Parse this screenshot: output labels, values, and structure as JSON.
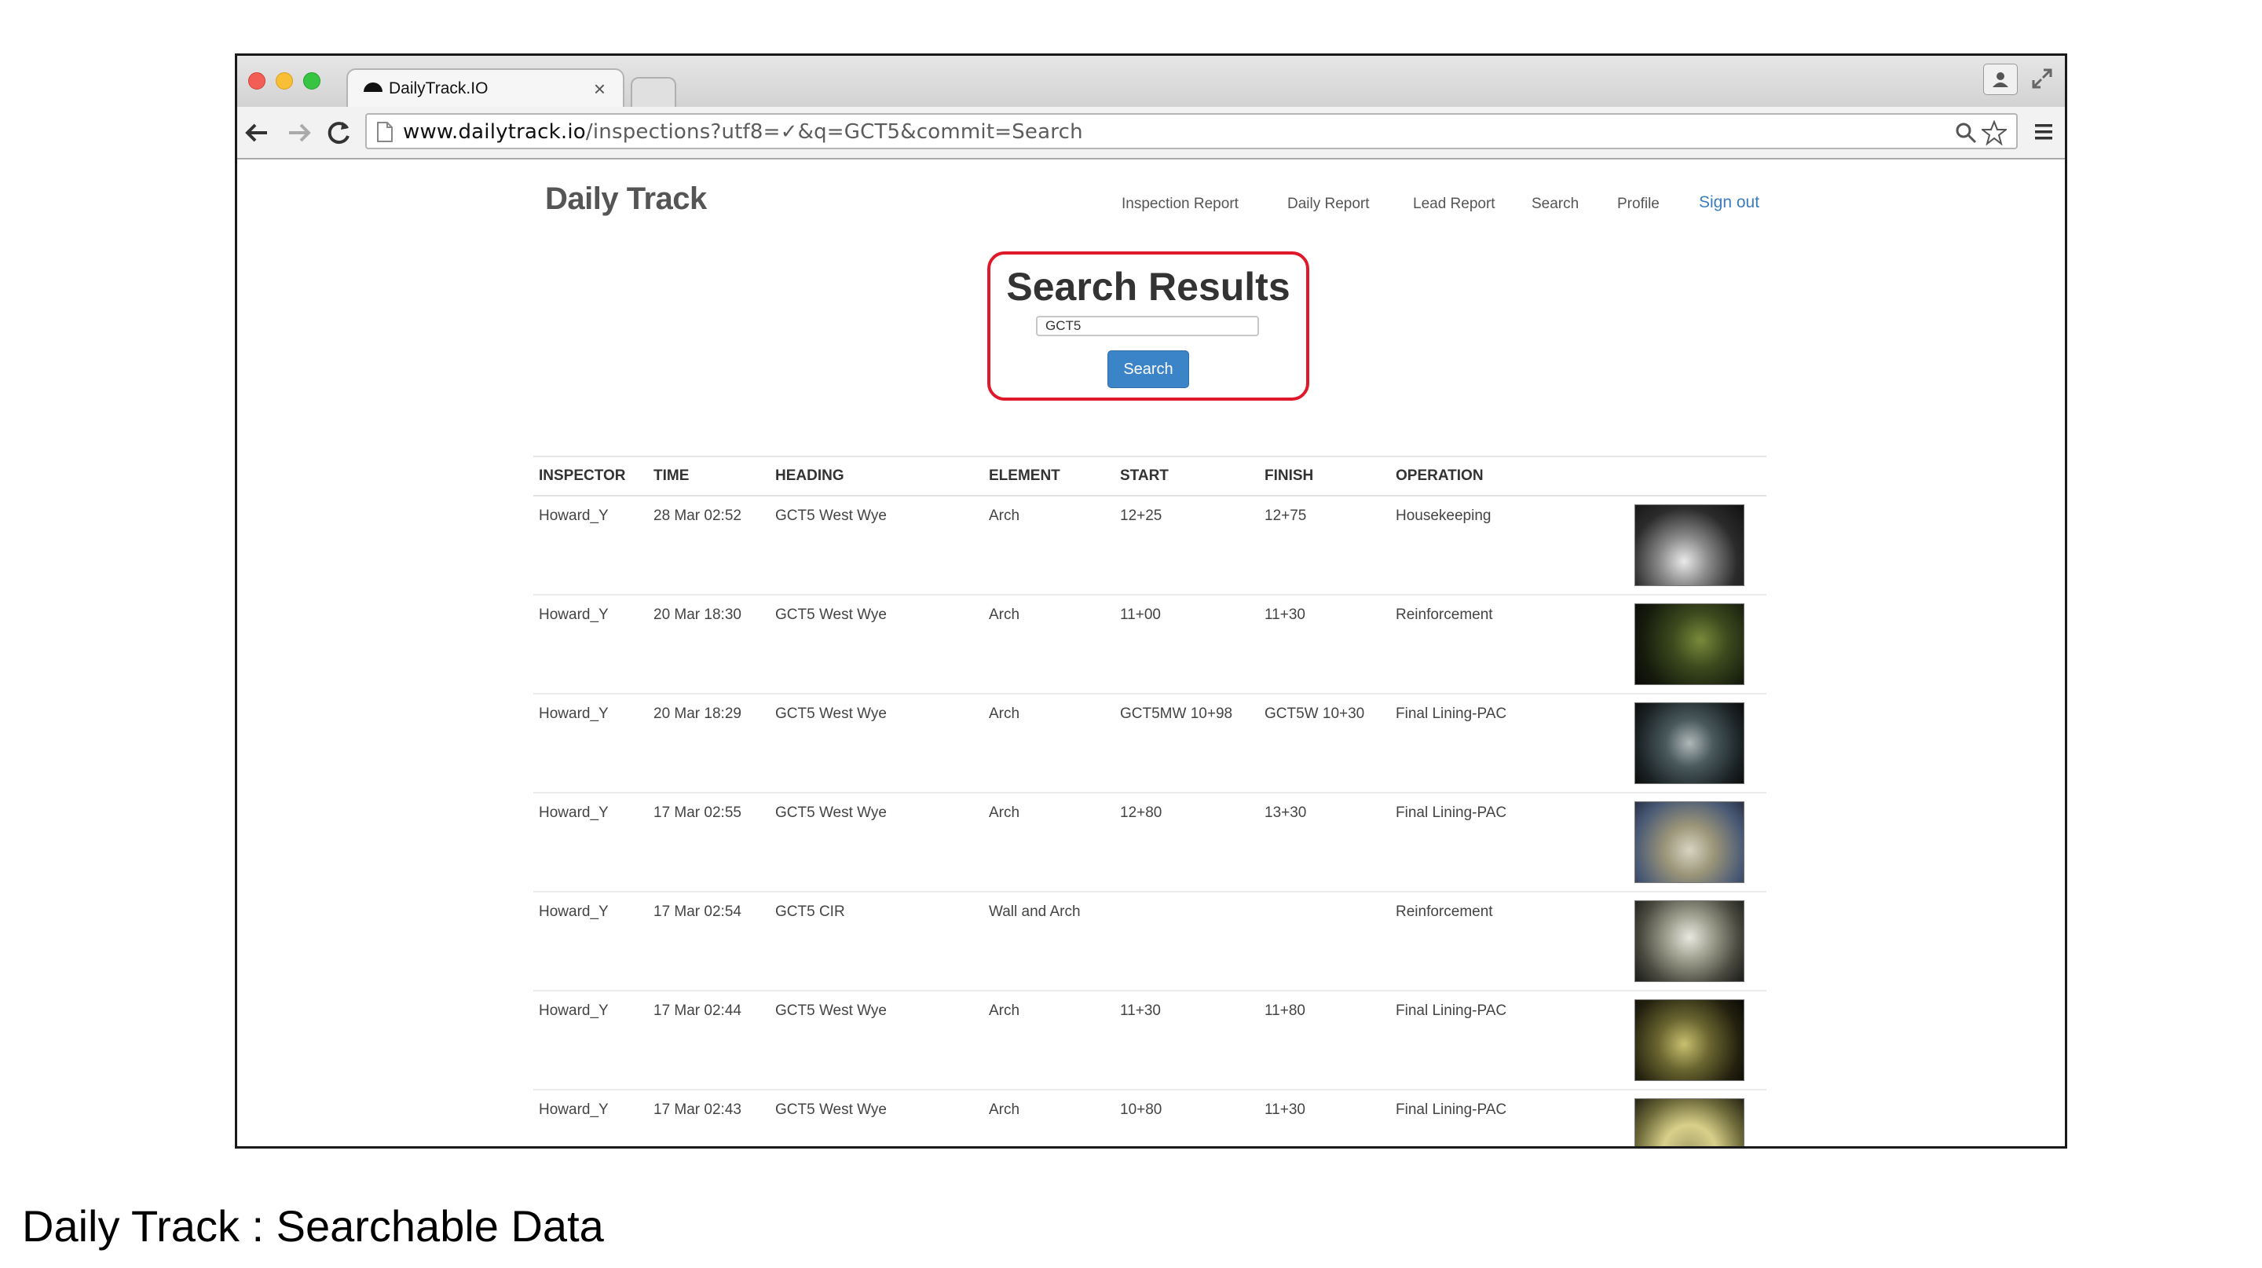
{
  "browser": {
    "tab_title": "DailyTrack.IO",
    "tab_close": "×",
    "url_host": "www.dailytrack.io",
    "url_path": "/inspections?utf8=✓&q=GCT5&commit=Search"
  },
  "header": {
    "brand": "Daily Track",
    "nav": {
      "inspection_report": "Inspection Report",
      "daily_report": "Daily Report",
      "lead_report": "Lead Report",
      "search": "Search",
      "profile": "Profile",
      "sign_out": "Sign out"
    }
  },
  "search": {
    "title": "Search Results",
    "query": "GCT5",
    "button_label": "Search"
  },
  "table": {
    "columns": {
      "inspector": "INSPECTOR",
      "time": "TIME",
      "heading": "HEADING",
      "element": "ELEMENT",
      "start": "START",
      "finish": "FINISH",
      "operation": "OPERATION"
    },
    "rows": [
      {
        "inspector": "Howard_Y",
        "time": "28 Mar 02:52",
        "heading": "GCT5 West Wye",
        "element": "Arch",
        "start": "12+25",
        "finish": "12+75",
        "operation": "Housekeeping"
      },
      {
        "inspector": "Howard_Y",
        "time": "20 Mar 18:30",
        "heading": "GCT5 West Wye",
        "element": "Arch",
        "start": "11+00",
        "finish": "11+30",
        "operation": "Reinforcement"
      },
      {
        "inspector": "Howard_Y",
        "time": "20 Mar 18:29",
        "heading": "GCT5 West Wye",
        "element": "Arch",
        "start": "GCT5MW 10+98",
        "finish": "GCT5W 10+30",
        "operation": "Final Lining-PAC"
      },
      {
        "inspector": "Howard_Y",
        "time": "17 Mar 02:55",
        "heading": "GCT5 West Wye",
        "element": "Arch",
        "start": "12+80",
        "finish": "13+30",
        "operation": "Final Lining-PAC"
      },
      {
        "inspector": "Howard_Y",
        "time": "17 Mar 02:54",
        "heading": "GCT5 CIR",
        "element": "Wall and Arch",
        "start": "",
        "finish": "",
        "operation": "Reinforcement"
      },
      {
        "inspector": "Howard_Y",
        "time": "17 Mar 02:44",
        "heading": "GCT5 West Wye",
        "element": "Arch",
        "start": "11+30",
        "finish": "11+80",
        "operation": "Final Lining-PAC"
      },
      {
        "inspector": "Howard_Y",
        "time": "17 Mar 02:43",
        "heading": "GCT5 West Wye",
        "element": "Arch",
        "start": "10+80",
        "finish": "11+30",
        "operation": "Final Lining-PAC"
      }
    ]
  },
  "caption": "Daily Track : Searchable Data",
  "colors": {
    "highlight_border": "#e0192a",
    "button_blue": "#3c84c8",
    "link_blue": "#3a7cc2"
  }
}
